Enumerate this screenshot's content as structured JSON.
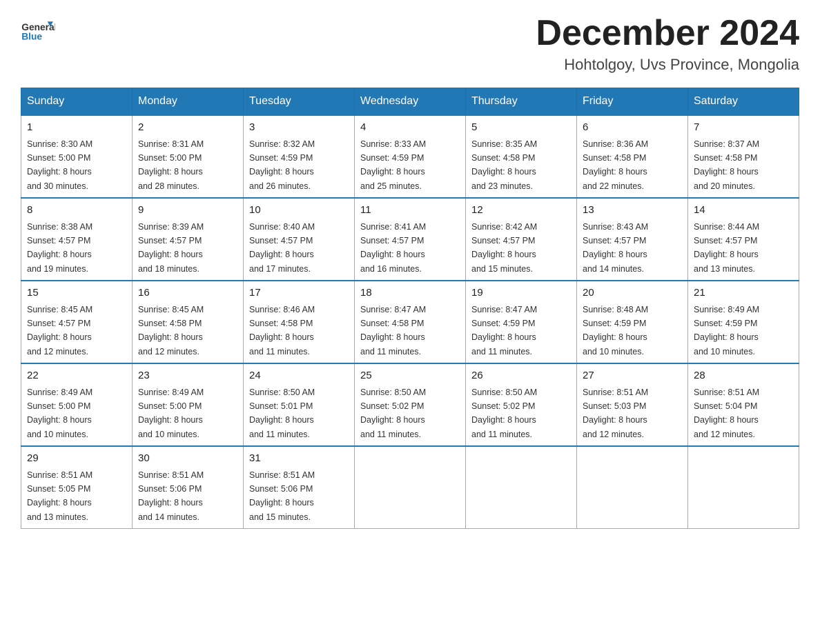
{
  "header": {
    "logo_general": "General",
    "logo_blue": "Blue",
    "month_title": "December 2024",
    "location": "Hohtolgoy, Uvs Province, Mongolia"
  },
  "weekdays": [
    "Sunday",
    "Monday",
    "Tuesday",
    "Wednesday",
    "Thursday",
    "Friday",
    "Saturday"
  ],
  "weeks": [
    [
      {
        "day": "1",
        "sunrise": "Sunrise: 8:30 AM",
        "sunset": "Sunset: 5:00 PM",
        "daylight": "Daylight: 8 hours",
        "minutes": "and 30 minutes."
      },
      {
        "day": "2",
        "sunrise": "Sunrise: 8:31 AM",
        "sunset": "Sunset: 5:00 PM",
        "daylight": "Daylight: 8 hours",
        "minutes": "and 28 minutes."
      },
      {
        "day": "3",
        "sunrise": "Sunrise: 8:32 AM",
        "sunset": "Sunset: 4:59 PM",
        "daylight": "Daylight: 8 hours",
        "minutes": "and 26 minutes."
      },
      {
        "day": "4",
        "sunrise": "Sunrise: 8:33 AM",
        "sunset": "Sunset: 4:59 PM",
        "daylight": "Daylight: 8 hours",
        "minutes": "and 25 minutes."
      },
      {
        "day": "5",
        "sunrise": "Sunrise: 8:35 AM",
        "sunset": "Sunset: 4:58 PM",
        "daylight": "Daylight: 8 hours",
        "minutes": "and 23 minutes."
      },
      {
        "day": "6",
        "sunrise": "Sunrise: 8:36 AM",
        "sunset": "Sunset: 4:58 PM",
        "daylight": "Daylight: 8 hours",
        "minutes": "and 22 minutes."
      },
      {
        "day": "7",
        "sunrise": "Sunrise: 8:37 AM",
        "sunset": "Sunset: 4:58 PM",
        "daylight": "Daylight: 8 hours",
        "minutes": "and 20 minutes."
      }
    ],
    [
      {
        "day": "8",
        "sunrise": "Sunrise: 8:38 AM",
        "sunset": "Sunset: 4:57 PM",
        "daylight": "Daylight: 8 hours",
        "minutes": "and 19 minutes."
      },
      {
        "day": "9",
        "sunrise": "Sunrise: 8:39 AM",
        "sunset": "Sunset: 4:57 PM",
        "daylight": "Daylight: 8 hours",
        "minutes": "and 18 minutes."
      },
      {
        "day": "10",
        "sunrise": "Sunrise: 8:40 AM",
        "sunset": "Sunset: 4:57 PM",
        "daylight": "Daylight: 8 hours",
        "minutes": "and 17 minutes."
      },
      {
        "day": "11",
        "sunrise": "Sunrise: 8:41 AM",
        "sunset": "Sunset: 4:57 PM",
        "daylight": "Daylight: 8 hours",
        "minutes": "and 16 minutes."
      },
      {
        "day": "12",
        "sunrise": "Sunrise: 8:42 AM",
        "sunset": "Sunset: 4:57 PM",
        "daylight": "Daylight: 8 hours",
        "minutes": "and 15 minutes."
      },
      {
        "day": "13",
        "sunrise": "Sunrise: 8:43 AM",
        "sunset": "Sunset: 4:57 PM",
        "daylight": "Daylight: 8 hours",
        "minutes": "and 14 minutes."
      },
      {
        "day": "14",
        "sunrise": "Sunrise: 8:44 AM",
        "sunset": "Sunset: 4:57 PM",
        "daylight": "Daylight: 8 hours",
        "minutes": "and 13 minutes."
      }
    ],
    [
      {
        "day": "15",
        "sunrise": "Sunrise: 8:45 AM",
        "sunset": "Sunset: 4:57 PM",
        "daylight": "Daylight: 8 hours",
        "minutes": "and 12 minutes."
      },
      {
        "day": "16",
        "sunrise": "Sunrise: 8:45 AM",
        "sunset": "Sunset: 4:58 PM",
        "daylight": "Daylight: 8 hours",
        "minutes": "and 12 minutes."
      },
      {
        "day": "17",
        "sunrise": "Sunrise: 8:46 AM",
        "sunset": "Sunset: 4:58 PM",
        "daylight": "Daylight: 8 hours",
        "minutes": "and 11 minutes."
      },
      {
        "day": "18",
        "sunrise": "Sunrise: 8:47 AM",
        "sunset": "Sunset: 4:58 PM",
        "daylight": "Daylight: 8 hours",
        "minutes": "and 11 minutes."
      },
      {
        "day": "19",
        "sunrise": "Sunrise: 8:47 AM",
        "sunset": "Sunset: 4:59 PM",
        "daylight": "Daylight: 8 hours",
        "minutes": "and 11 minutes."
      },
      {
        "day": "20",
        "sunrise": "Sunrise: 8:48 AM",
        "sunset": "Sunset: 4:59 PM",
        "daylight": "Daylight: 8 hours",
        "minutes": "and 10 minutes."
      },
      {
        "day": "21",
        "sunrise": "Sunrise: 8:49 AM",
        "sunset": "Sunset: 4:59 PM",
        "daylight": "Daylight: 8 hours",
        "minutes": "and 10 minutes."
      }
    ],
    [
      {
        "day": "22",
        "sunrise": "Sunrise: 8:49 AM",
        "sunset": "Sunset: 5:00 PM",
        "daylight": "Daylight: 8 hours",
        "minutes": "and 10 minutes."
      },
      {
        "day": "23",
        "sunrise": "Sunrise: 8:49 AM",
        "sunset": "Sunset: 5:00 PM",
        "daylight": "Daylight: 8 hours",
        "minutes": "and 10 minutes."
      },
      {
        "day": "24",
        "sunrise": "Sunrise: 8:50 AM",
        "sunset": "Sunset: 5:01 PM",
        "daylight": "Daylight: 8 hours",
        "minutes": "and 11 minutes."
      },
      {
        "day": "25",
        "sunrise": "Sunrise: 8:50 AM",
        "sunset": "Sunset: 5:02 PM",
        "daylight": "Daylight: 8 hours",
        "minutes": "and 11 minutes."
      },
      {
        "day": "26",
        "sunrise": "Sunrise: 8:50 AM",
        "sunset": "Sunset: 5:02 PM",
        "daylight": "Daylight: 8 hours",
        "minutes": "and 11 minutes."
      },
      {
        "day": "27",
        "sunrise": "Sunrise: 8:51 AM",
        "sunset": "Sunset: 5:03 PM",
        "daylight": "Daylight: 8 hours",
        "minutes": "and 12 minutes."
      },
      {
        "day": "28",
        "sunrise": "Sunrise: 8:51 AM",
        "sunset": "Sunset: 5:04 PM",
        "daylight": "Daylight: 8 hours",
        "minutes": "and 12 minutes."
      }
    ],
    [
      {
        "day": "29",
        "sunrise": "Sunrise: 8:51 AM",
        "sunset": "Sunset: 5:05 PM",
        "daylight": "Daylight: 8 hours",
        "minutes": "and 13 minutes."
      },
      {
        "day": "30",
        "sunrise": "Sunrise: 8:51 AM",
        "sunset": "Sunset: 5:06 PM",
        "daylight": "Daylight: 8 hours",
        "minutes": "and 14 minutes."
      },
      {
        "day": "31",
        "sunrise": "Sunrise: 8:51 AM",
        "sunset": "Sunset: 5:06 PM",
        "daylight": "Daylight: 8 hours",
        "minutes": "and 15 minutes."
      },
      null,
      null,
      null,
      null
    ]
  ]
}
